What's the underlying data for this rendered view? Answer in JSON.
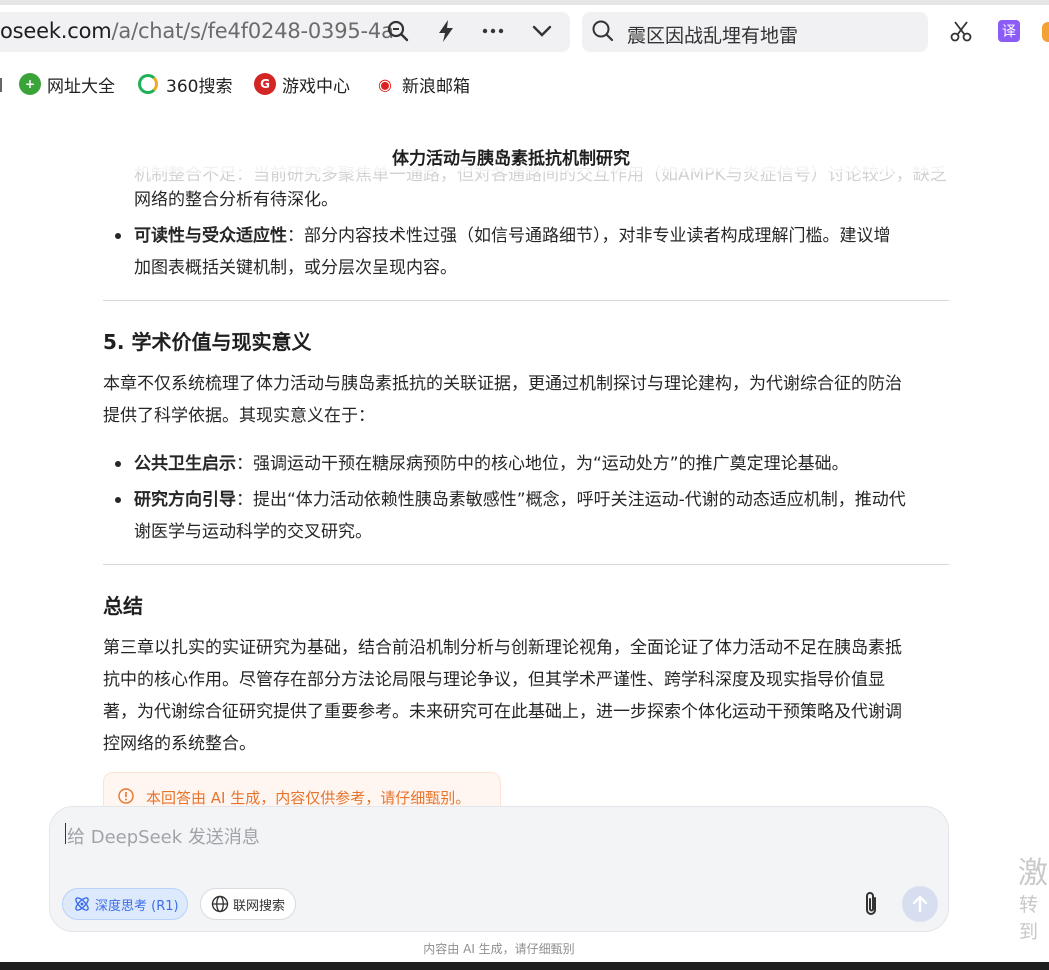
{
  "browser": {
    "url_main": "oseek.com",
    "url_path": "/a/chat/s/fe4f0248-0395-4a",
    "search_query": "震区因战乱埋有地雷",
    "bookmarks": [
      {
        "label": "网址大全"
      },
      {
        "label": "360搜索"
      },
      {
        "label": "游戏中心"
      },
      {
        "label": "新浪邮箱"
      }
    ],
    "translate_label": "译"
  },
  "chat": {
    "title": "体力活动与胰岛素抵抗机制研究",
    "faded_line": "机制整合不足：当前研究多聚焦单一通路，但对各通路间的交互作用（如AMPK与炎症信号）讨论较少，缺乏",
    "para_prev": "网络的整合分析有待深化。",
    "bullet_readability_title": "可读性与受众适应性",
    "bullet_readability_text_1": "：部分内容技术性过强（如信号通路细节），对非专业读者构成理解门槛。建议增",
    "bullet_readability_text_2": "加图表概括关键机制，或分层次呈现内容。",
    "section5_heading": "5. 学术价值与现实意义",
    "section5_p1_line1": "本章不仅系统梳理了体力活动与胰岛素抵抗的关联证据，更通过机制探讨与理论建构，为代谢综合征的防治",
    "section5_p1_line2": "提供了科学依据。其现实意义在于：",
    "bullet_public_title": "公共卫生启示",
    "bullet_public_text": "：强调运动干预在糖尿病预防中的核心地位，为“运动处方”的推广奠定理论基础。",
    "bullet_research_title": "研究方向引导",
    "bullet_research_text_1": "：提出“体力活动依赖性胰岛素敏感性”概念，呼吁关注运动-代谢的动态适应机制，推动代",
    "bullet_research_text_2": "谢医学与运动科学的交叉研究。",
    "summary_heading": "总结",
    "summary_line1": "第三章以扎实的实证研究为基础，结合前沿机制分析与创新理论视角，全面论证了体力活动不足在胰岛素抵",
    "summary_line2": "抗中的核心作用。尽管存在部分方法论局限与理论争议，但其学术严谨性、跨学科深度及现实指导价值显",
    "summary_line3": "著，为代谢综合征研究提供了重要参考。未来研究可在此基础上，进一步探索个体化运动干预策略及代谢调",
    "summary_line4": "控网络的系统整合。",
    "disclaimer": "本回答由 AI 生成，内容仅供参考，请仔细甄别。"
  },
  "composer": {
    "placeholder": "给 DeepSeek 发送消息",
    "deep_think_label": "深度思考 (R1)",
    "web_search_label": "联网搜索",
    "footer_note": "内容由 AI 生成，请仔细甄别"
  },
  "side_text": {
    "activate": "激",
    "goto": "转到"
  },
  "colors": {
    "accent_blue": "#3d6ee8",
    "disclaimer_orange": "#e8742c"
  }
}
